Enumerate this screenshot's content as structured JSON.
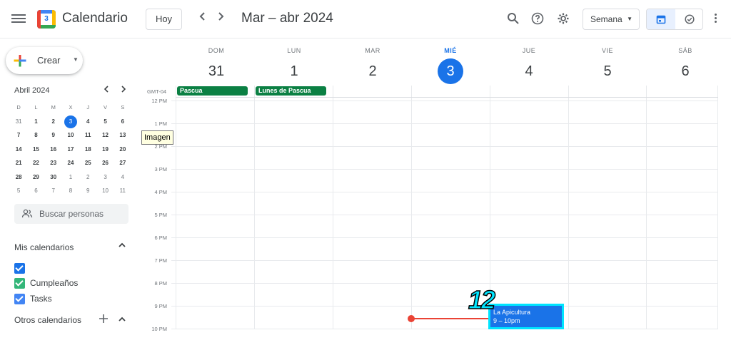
{
  "header": {
    "app_title": "Calendario",
    "today_label": "Hoy",
    "date_range": "Mar – abr 2024",
    "view_label": "Semana"
  },
  "sidebar": {
    "create_label": "Crear",
    "mini_cal": {
      "title": "Abril 2024",
      "weekday_headers": [
        "D",
        "L",
        "M",
        "X",
        "J",
        "V",
        "S"
      ],
      "weeks": [
        [
          "31",
          "1",
          "2",
          "3",
          "4",
          "5",
          "6"
        ],
        [
          "7",
          "8",
          "9",
          "10",
          "11",
          "12",
          "13"
        ],
        [
          "14",
          "15",
          "16",
          "17",
          "18",
          "19",
          "20"
        ],
        [
          "21",
          "22",
          "23",
          "24",
          "25",
          "26",
          "27"
        ],
        [
          "28",
          "29",
          "30",
          "1",
          "2",
          "3",
          "4"
        ],
        [
          "5",
          "6",
          "7",
          "8",
          "9",
          "10",
          "11"
        ]
      ]
    },
    "people_search_placeholder": "Buscar personas",
    "my_calendars_title": "Mis calendarios",
    "my_calendars": [
      {
        "name": "",
        "color": "#1a73e8"
      },
      {
        "name": "Cumpleaños",
        "color": "#33b679"
      },
      {
        "name": "Tasks",
        "color": "#4285f4"
      }
    ],
    "other_calendars_title": "Otros calendarios"
  },
  "week": {
    "days": [
      {
        "weekday": "DOM",
        "date": "31"
      },
      {
        "weekday": "LUN",
        "date": "1"
      },
      {
        "weekday": "MAR",
        "date": "2"
      },
      {
        "weekday": "MIÉ",
        "date": "3"
      },
      {
        "weekday": "JUE",
        "date": "4"
      },
      {
        "weekday": "VIE",
        "date": "5"
      },
      {
        "weekday": "SÁB",
        "date": "6"
      }
    ],
    "timezone": "GMT-04",
    "hours": [
      "12 PM",
      "1 PM",
      "2 PM",
      "3 PM",
      "4 PM",
      "5 PM",
      "6 PM",
      "7 PM",
      "8 PM",
      "9 PM",
      "10 PM"
    ],
    "all_day_events": [
      {
        "title": "Pascua",
        "color": "#0b8043"
      },
      {
        "title": "Lunes de Pascua",
        "color": "#0b8043"
      }
    ],
    "event": {
      "title": "La Apicultura",
      "time": "9 – 10pm",
      "color": "#1a73e8"
    },
    "tooltip": "Imagen",
    "annotation_number": "12"
  },
  "colors": {
    "accent": "#1a73e8",
    "now_line": "#ea4335",
    "highlight": "#00e5ff"
  }
}
